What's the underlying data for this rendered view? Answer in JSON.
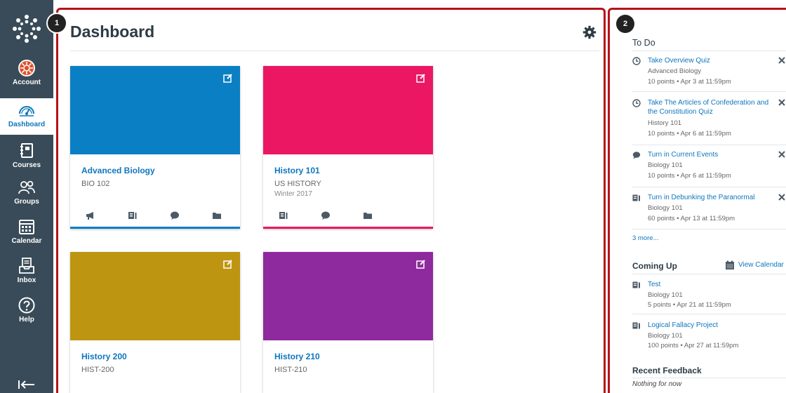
{
  "nav": {
    "items": [
      {
        "label": "Account",
        "icon": "account-avatar-icon"
      },
      {
        "label": "Dashboard",
        "icon": "dashboard-gauge-icon"
      },
      {
        "label": "Courses",
        "icon": "courses-book-icon"
      },
      {
        "label": "Groups",
        "icon": "groups-people-icon"
      },
      {
        "label": "Calendar",
        "icon": "calendar-icon"
      },
      {
        "label": "Inbox",
        "icon": "inbox-icon"
      },
      {
        "label": "Help",
        "icon": "help-icon"
      }
    ],
    "active": "Dashboard"
  },
  "callouts": {
    "main": "1",
    "sidebar": "2"
  },
  "dashboard": {
    "title": "Dashboard",
    "cards": [
      {
        "name": "Advanced Biology",
        "code": "BIO 102",
        "term": "",
        "color": "#0b7fc4"
      },
      {
        "name": "History 101",
        "code": "US HISTORY",
        "term": "Winter 2017",
        "color": "#ec1763"
      },
      {
        "name": "History 200",
        "code": "HIST-200",
        "term": "",
        "color": "#be9511"
      },
      {
        "name": "History 210",
        "code": "HIST-210",
        "term": "",
        "color": "#8e2a9d"
      }
    ]
  },
  "sidebar": {
    "todo_heading": "To Do",
    "todo": [
      {
        "title": "Take Overview Quiz",
        "course": "Advanced Biology",
        "meta": "10 points • Apr 3 at 11:59pm",
        "icon": "quiz-icon"
      },
      {
        "title": "Take The Articles of Confederation and the Constitution Quiz",
        "course": "History 101",
        "meta": "10 points • Apr 6 at 11:59pm",
        "icon": "quiz-icon"
      },
      {
        "title": "Turn in Current Events",
        "course": "Biology 101",
        "meta": "10 points • Apr 6 at 11:59pm",
        "icon": "discussion-icon"
      },
      {
        "title": "Turn in Debunking the Paranormal",
        "course": "Biology 101",
        "meta": "60 points • Apr 13 at 11:59pm",
        "icon": "assignment-icon"
      }
    ],
    "more_link": "3 more...",
    "coming_up_heading": "Coming Up",
    "view_calendar": "View Calendar",
    "coming_up": [
      {
        "title": "Test",
        "course": "Biology 101",
        "meta": "5 points • Apr 21 at 11:59pm",
        "icon": "assignment-icon"
      },
      {
        "title": "Logical Fallacy Project",
        "course": "Biology 101",
        "meta": "100 points • Apr 27 at 11:59pm",
        "icon": "assignment-icon"
      }
    ],
    "feedback_heading": "Recent Feedback",
    "feedback_empty": "Nothing for now"
  },
  "colors": {
    "nav_bg": "#394b58",
    "link": "#0e76bd",
    "callout_frame": "#b5121b"
  }
}
